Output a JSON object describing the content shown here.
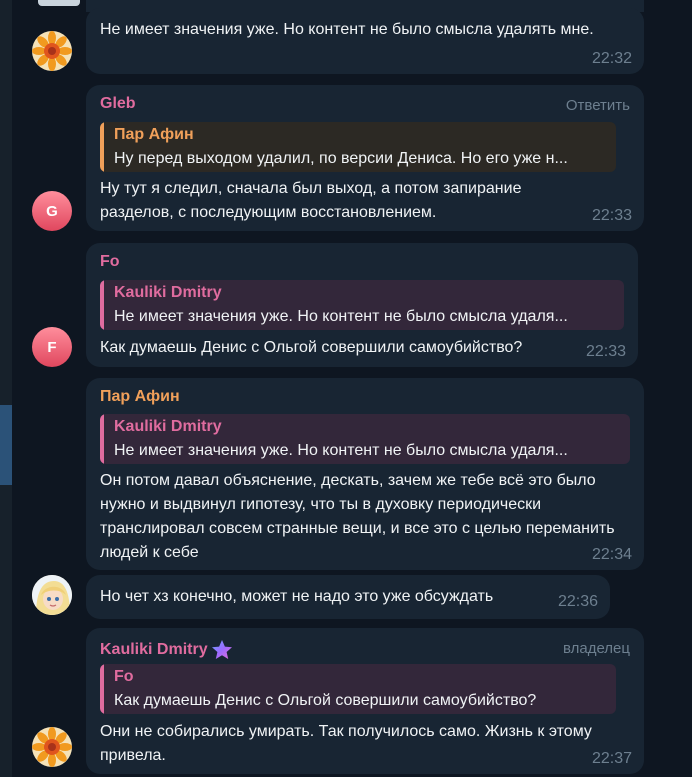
{
  "messages": [
    {
      "text": "Не имеет значения уже. Но контент не было смысла удалять мне.",
      "time": "22:32"
    },
    {
      "sender": "Gleb",
      "reply_action": "Ответить",
      "quote": {
        "name": "Пар Афин",
        "text": "Ну перед выходом удалил, по версии Дениса. Но его уже н..."
      },
      "text": "Ну тут я следил, сначала был выход, а потом запирание разделов, с последующим восстановлением.",
      "time": "22:33",
      "avatar_letter": "G"
    },
    {
      "sender": "Fo",
      "quote": {
        "name": "Kauliki Dmitry",
        "text": "Не имеет значения уже. Но контент не было смысла удаля..."
      },
      "text": "Как думаешь Денис с Ольгой совершили самоубийство?",
      "time": "22:33",
      "avatar_letter": "F"
    },
    {
      "sender": "Пар Афин",
      "quote": {
        "name": "Kauliki Dmitry",
        "text": "Не имеет значения уже. Но контент не было смысла удаля..."
      },
      "text": "Он потом давал объяснение, дескать, зачем же тебе всё это было нужно и выдвинул гипотезу, что ты в духовку периодически транслировал совсем странные вещи, и все это с целью переманить людей к себе",
      "time": "22:34"
    },
    {
      "text": "Но чет хз конечно, может не надо это уже обсуждать",
      "time": "22:36"
    },
    {
      "sender": "Kauliki Dmitry",
      "role": "владелец",
      "quote": {
        "name": "Fo",
        "text": "Как думаешь Денис с Ольгой совершили самоубийство?"
      },
      "text": "Они не собирались умирать. Так получилось само. Жизнь к этому привела.",
      "time": "22:37"
    }
  ],
  "colors": {
    "background": "#0e1621",
    "bubble": "#182533",
    "gleb_name": "#e06c9f",
    "fo_name": "#e06c9f",
    "par_afin_name": "#f0a05a",
    "kauliki_name": "#e06c9f",
    "timestamp": "#6d7f8f"
  },
  "icons": {
    "premium_badge": "star-icon"
  }
}
